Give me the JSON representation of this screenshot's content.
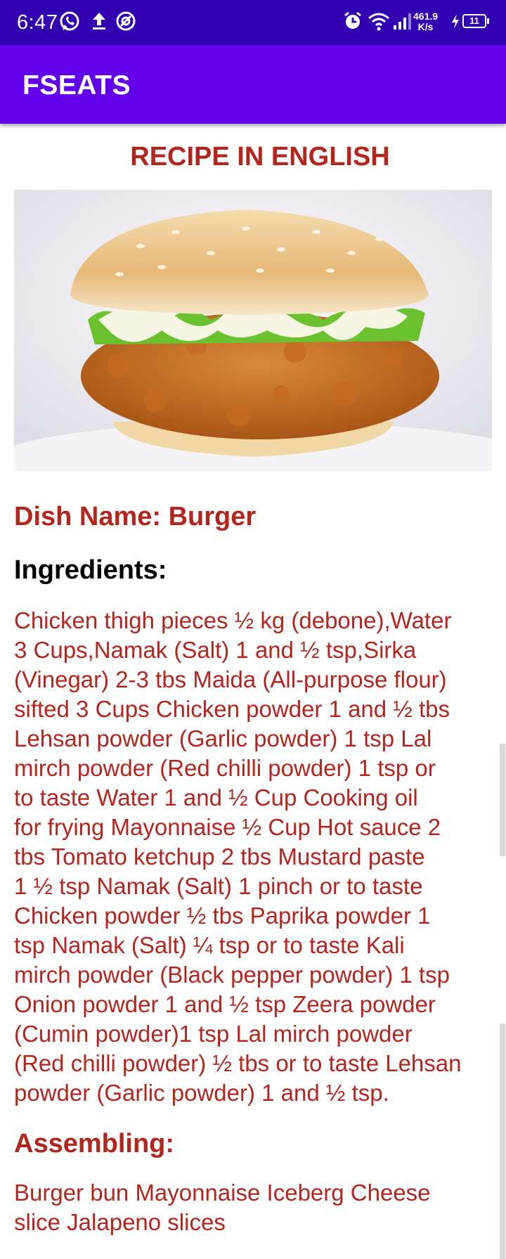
{
  "status_bar": {
    "time": "6:47",
    "speed_value": "461.9",
    "speed_unit": "K/s",
    "battery": "11",
    "icons": [
      "whatsapp-icon",
      "upload-icon",
      "vpn-icon",
      "alarm-icon",
      "wifi-icon",
      "signal-icon",
      "charging-icon",
      "battery-icon"
    ]
  },
  "app_bar": {
    "title": "FSEATS"
  },
  "recipe": {
    "heading": "RECIPE IN ENGLISH",
    "dish_name": "Dish Name: Burger",
    "ingredients_title": "Ingredients:",
    "ingredients_text": "Chicken thigh pieces ½ kg (debone),Water\n3 Cups,Namak (Salt) 1 and ½ tsp,Sirka\n(Vinegar) 2-3 tbs Maida (All-purpose flour)\nsifted 3 Cups Chicken powder 1 and ½ tbs\nLehsan powder (Garlic powder) 1 tsp Lal\nmirch powder (Red chilli powder) 1 tsp or\nto taste Water 1 and ½ Cup Cooking oil\nfor frying Mayonnaise ½ Cup Hot sauce 2\ntbs Tomato ketchup 2 tbs Mustard paste\n1  ½ tsp Namak (Salt) 1 pinch or to taste\nChicken powder ½ tbs Paprika powder 1\ntsp Namak (Salt) ¼ tsp or to taste Kali\nmirch powder (Black pepper powder) 1 tsp\nOnion powder 1 and ½ tsp Zeera powder\n(Cumin powder)1 tsp Lal mirch powder\n(Red chilli powder) ½ tbs or to taste Lehsan\npowder (Garlic powder) 1 and ½ tsp.",
    "assembling_title": "Assembling:",
    "assembling_text": "Burger bun Mayonnaise Iceberg Cheese\nslice Jalapeno slices"
  },
  "colors": {
    "status_bar": "#3200b0",
    "app_bar": "#6200ea",
    "accent_text": "#b3261e"
  }
}
